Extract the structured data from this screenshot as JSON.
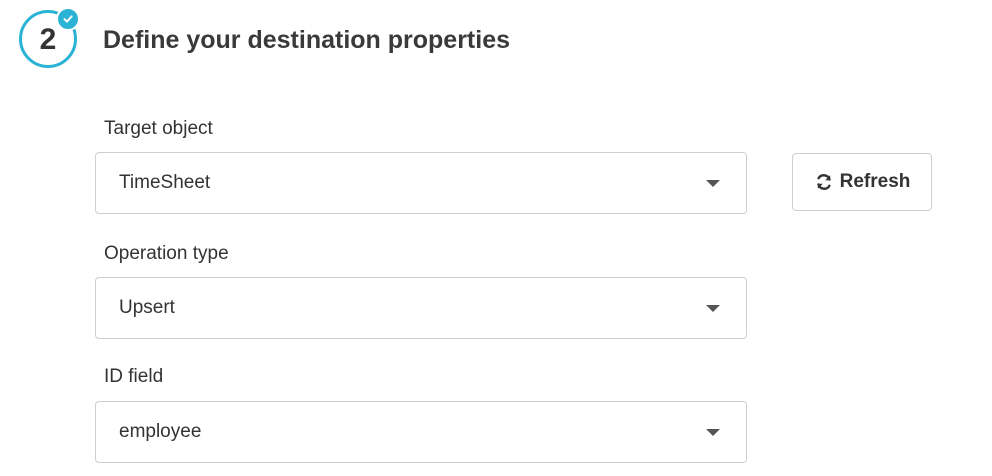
{
  "step": {
    "number": "2",
    "title": "Define your destination properties",
    "status_icon": "check-icon",
    "accent_color": "#2bb3d6"
  },
  "fields": {
    "target_object": {
      "label": "Target object",
      "value": "TimeSheet"
    },
    "operation_type": {
      "label": "Operation type",
      "value": "Upsert"
    },
    "id_field": {
      "label": "ID field",
      "value": "employee"
    }
  },
  "refresh": {
    "label": "Refresh",
    "icon": "refresh-icon"
  }
}
